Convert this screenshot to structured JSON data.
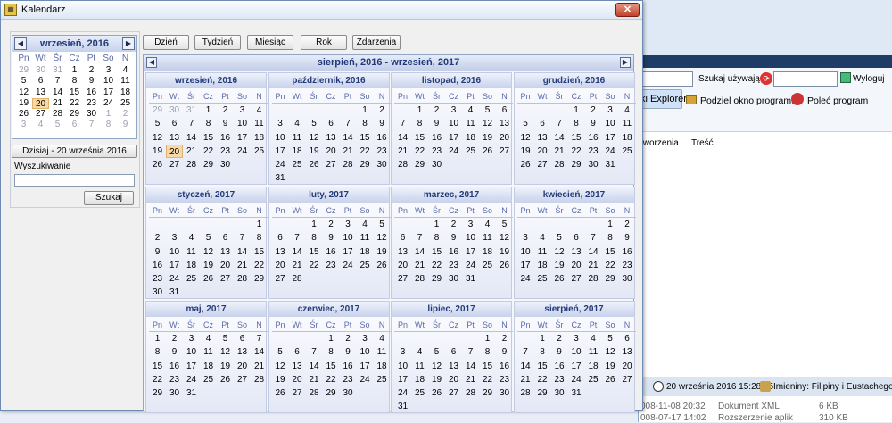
{
  "window": {
    "title": "Kalendarz",
    "close": "✕"
  },
  "background_app": {
    "search_label": "Szukaj używając",
    "logout": "Wyloguj",
    "toolbar": [
      "ki Explorer",
      "Podziel okno programu",
      "Poleć program"
    ],
    "columns": [
      "tworzenia",
      "Treść"
    ],
    "status": [
      "20 września 2016 15:28:25",
      "Imieniny: Filipiny i Eustachego"
    ],
    "rows": [
      {
        "date": "008-11-08 20:32",
        "type": "Dokument XML",
        "size": "6 KB"
      },
      {
        "date": "008-07-17 14:02",
        "type": "Rozszerzenie aplik",
        "size": "310 KB"
      }
    ]
  },
  "mini_calendar": {
    "title": "wrzesień, 2016",
    "prev": "◀",
    "next": "▶",
    "weekdays": [
      "Pn",
      "Wt",
      "Śr",
      "Cz",
      "Pt",
      "So",
      "N"
    ],
    "days": [
      [
        "29",
        "dim"
      ],
      [
        "30",
        "dim"
      ],
      [
        "31",
        "dim"
      ],
      [
        "1",
        ""
      ],
      [
        "2",
        ""
      ],
      [
        "3",
        ""
      ],
      [
        "4",
        ""
      ],
      [
        "5",
        ""
      ],
      [
        "6",
        ""
      ],
      [
        "7",
        ""
      ],
      [
        "8",
        ""
      ],
      [
        "9",
        ""
      ],
      [
        "10",
        ""
      ],
      [
        "11",
        ""
      ],
      [
        "12",
        ""
      ],
      [
        "13",
        ""
      ],
      [
        "14",
        ""
      ],
      [
        "15",
        ""
      ],
      [
        "16",
        ""
      ],
      [
        "17",
        ""
      ],
      [
        "18",
        ""
      ],
      [
        "19",
        ""
      ],
      [
        "20",
        "today"
      ],
      [
        "21",
        ""
      ],
      [
        "22",
        ""
      ],
      [
        "23",
        ""
      ],
      [
        "24",
        ""
      ],
      [
        "25",
        ""
      ],
      [
        "26",
        ""
      ],
      [
        "27",
        ""
      ],
      [
        "28",
        ""
      ],
      [
        "29",
        ""
      ],
      [
        "30",
        ""
      ],
      [
        "1",
        "dim"
      ],
      [
        "2",
        "dim"
      ],
      [
        "3",
        "dim"
      ],
      [
        "4",
        "dim"
      ],
      [
        "5",
        "dim"
      ],
      [
        "6",
        "dim"
      ],
      [
        "7",
        "dim"
      ],
      [
        "8",
        "dim"
      ],
      [
        "9",
        "dim"
      ]
    ]
  },
  "today_button": "Dzisiaj - 20 września 2016",
  "search": {
    "label": "Wyszukiwanie",
    "value": "",
    "button": "Szukaj"
  },
  "view_buttons": [
    "Dzień",
    "Tydzień",
    "Miesiąc",
    "Rok",
    "Zdarzenia"
  ],
  "year_view": {
    "title": "sierpień, 2016 - wrzesień, 2017",
    "prev": "◀",
    "next": "▶",
    "weekdays": [
      "Pn",
      "Wt",
      "Śr",
      "Cz",
      "Pt",
      "So",
      "N"
    ],
    "months": [
      {
        "title": "wrzesień, 2016",
        "lead": [
          29,
          30,
          31
        ],
        "leadDim": true,
        "days": 30,
        "today": 20
      },
      {
        "title": "październik, 2016",
        "lead": 5,
        "days": 31
      },
      {
        "title": "listopad, 2016",
        "lead": 1,
        "days": 30
      },
      {
        "title": "grudzień, 2016",
        "lead": 3,
        "days": 31
      },
      {
        "title": "styczeń, 2017",
        "lead": 6,
        "days": 31
      },
      {
        "title": "luty, 2017",
        "lead": 2,
        "days": 28
      },
      {
        "title": "marzec, 2017",
        "lead": 2,
        "days": 31
      },
      {
        "title": "kwiecień, 2017",
        "lead": 5,
        "days": 30
      },
      {
        "title": "maj, 2017",
        "lead": 0,
        "days": 31
      },
      {
        "title": "czerwiec, 2017",
        "lead": 3,
        "days": 30
      },
      {
        "title": "lipiec, 2017",
        "lead": 5,
        "days": 31
      },
      {
        "title": "sierpień, 2017",
        "lead": 1,
        "days": 31
      }
    ]
  }
}
